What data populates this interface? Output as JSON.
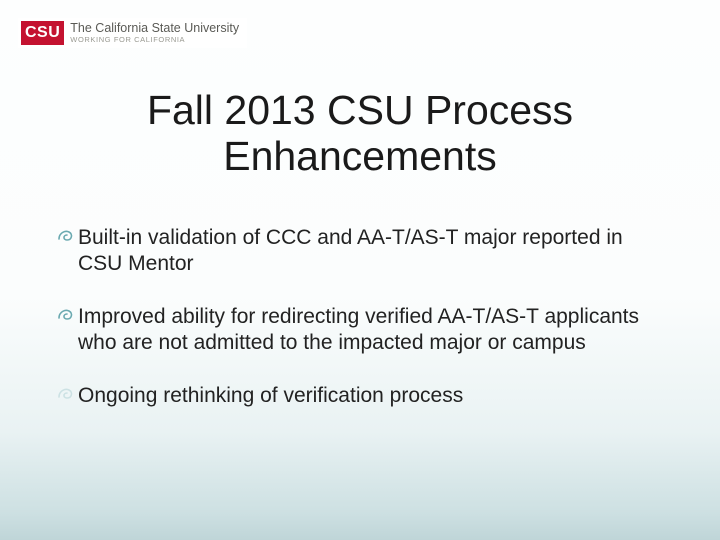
{
  "logo": {
    "badge": "CSU",
    "title": "The California State University",
    "subtitle": "WORKING FOR CALIFORNIA"
  },
  "slide": {
    "title_line1": "Fall 2013 CSU Process",
    "title_line2": "Enhancements"
  },
  "bullets": [
    {
      "text": "Built-in validation of CCC and AA-T/AS-T major reported in CSU Mentor"
    },
    {
      "text": "Improved ability for redirecting verified AA-T/AS-T applicants who are not admitted to the impacted major or campus"
    },
    {
      "text": "Ongoing rethinking of verification process"
    }
  ]
}
